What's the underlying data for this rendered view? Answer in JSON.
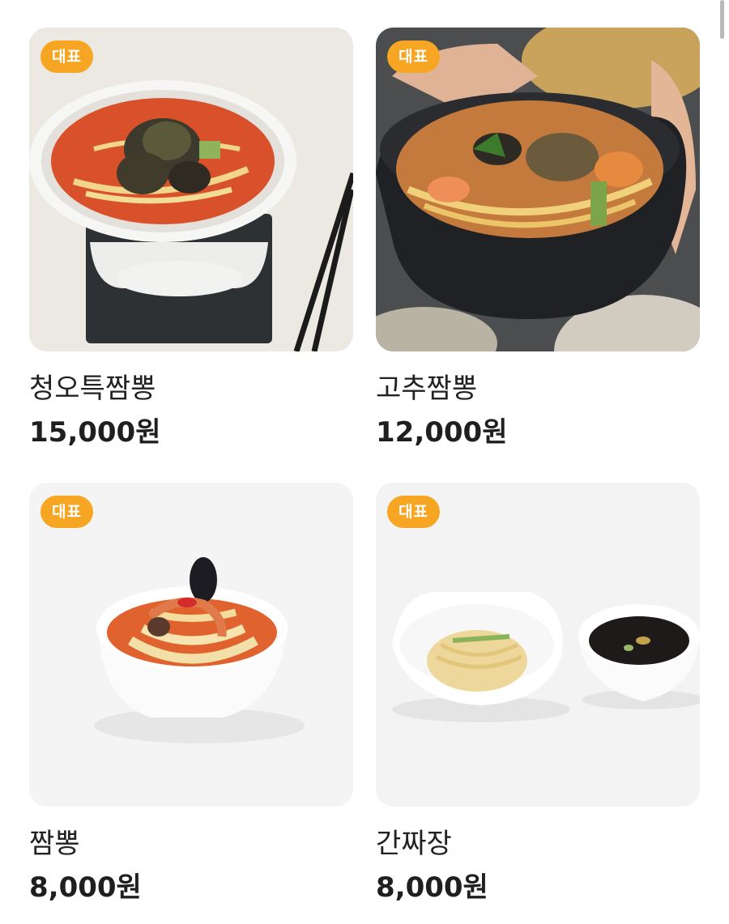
{
  "menu": {
    "items": [
      {
        "badge": "대표",
        "name": "청오특짬뽕",
        "price": "15,000원",
        "image_icon": "spicy-abalone-noodle-soup-photo"
      },
      {
        "badge": "대표",
        "name": "고추짬뽕",
        "price": "12,000원",
        "image_icon": "chili-seafood-noodle-bowl-photo"
      },
      {
        "badge": "대표",
        "name": "짬뽕",
        "price": "8,000원",
        "image_icon": "seafood-noodle-soup-photo"
      },
      {
        "badge": "대표",
        "name": "간짜장",
        "price": "8,000원",
        "image_icon": "black-bean-noodle-photo"
      }
    ]
  },
  "colors": {
    "badge_background": "#f6a623",
    "badge_text": "#ffffff",
    "name_text": "#222222",
    "price_text": "#1f1f1f"
  }
}
